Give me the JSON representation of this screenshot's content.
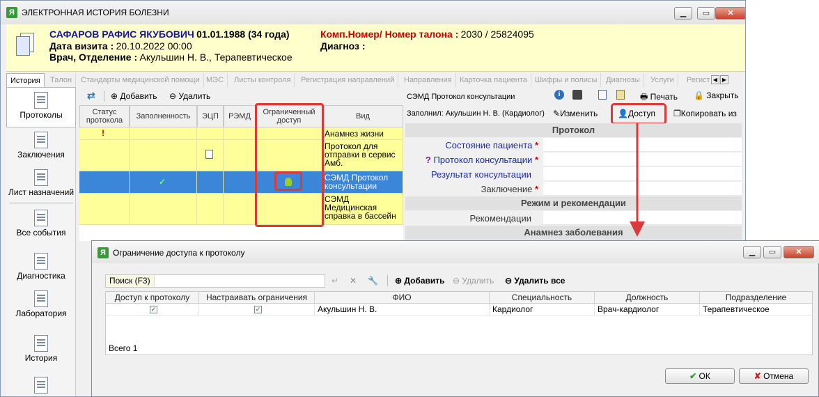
{
  "window": {
    "title": "ЭЛЕКТРОННАЯ ИСТОРИЯ БОЛЕЗНИ",
    "app_icon": "Я"
  },
  "patient": {
    "name_dob": "САФАРОВ РАФИС ЯКУБОВИЧ",
    "dob": "01.01.1988 (34 года)",
    "visit_label": "Дата визита :",
    "visit_value": "20.10.2022 00:00",
    "doctor_label": "Врач, Отделение :",
    "doctor_value": "Акульшин Н. В., Терапевтическое",
    "comp_label": "Комп.Номер/ Номер талона :",
    "comp_value": "2030 / 25824095",
    "diag_label": "Диагноз :"
  },
  "tabs": [
    "История",
    "Талон",
    "Стандарты медицинской помощи",
    "МЭС",
    "Листы контроля",
    "Регистрация направлений",
    "Направления",
    "Карточка пациента",
    "Шифры и полисы",
    "Диагнозы",
    "Услуги",
    "Регист"
  ],
  "sidebar": [
    "Протоколы",
    "Заключения",
    "Лист назначений",
    "Все события",
    "Диагностика",
    "Лаборатория",
    "История"
  ],
  "toolbar": {
    "add": "Добавить",
    "delete": "Удалить"
  },
  "grid": {
    "headers": [
      "Статус протокола",
      "Заполненность",
      "ЭЦП",
      "РЭМД",
      "Ограниченный доступ",
      "Вид"
    ],
    "rows": [
      {
        "vid": "Анамнез жизни"
      },
      {
        "vid": "Протокол для отправки в сервис Амб."
      },
      {
        "vid": "СЭМД Протокол консультации"
      },
      {
        "vid": "СЭМД Медицинская справка в бассейн"
      }
    ]
  },
  "right_panel": {
    "doc_title": "СЭМД Протокол консультации",
    "filled_by": "Заполнил: Акульшин Н. В. (Кардиолог)",
    "print": "Печать",
    "close": "Закрыть",
    "edit": "Изменить",
    "access": "Доступ",
    "copy": "Копировать из",
    "sections": {
      "protocol": "Протокол",
      "regime": "Режим и рекомендации",
      "anamnesis": "Анамнез заболевания"
    },
    "fields": {
      "state": "Состояние пациента",
      "consult_protocol": "Протокол консультации",
      "consult_result": "Результат консультации",
      "conclusion": "Заключение",
      "recommendations": "Рекомендации"
    }
  },
  "dialog": {
    "title": "Ограничение доступа к протоколу",
    "search_placeholder": "Поиск (F3)",
    "add": "Добавить",
    "delete": "Удалить",
    "delete_all": "Удалить все",
    "headers": [
      "Доступ к протоколу",
      "Настраивать ограничения",
      "ФИО",
      "Специальность",
      "Должность",
      "Подразделение"
    ],
    "row": {
      "fio": "Акульшин Н. В.",
      "specialty": "Кардиолог",
      "position": "Врач-кардиолог",
      "department": "Терапевтическое"
    },
    "total": "Всего 1",
    "ok": "ОК",
    "cancel": "Отмена"
  },
  "colors": {
    "accent_red": "#d93a3a",
    "row_yellow": "#ffff99",
    "selected_blue": "#3b86d8"
  }
}
